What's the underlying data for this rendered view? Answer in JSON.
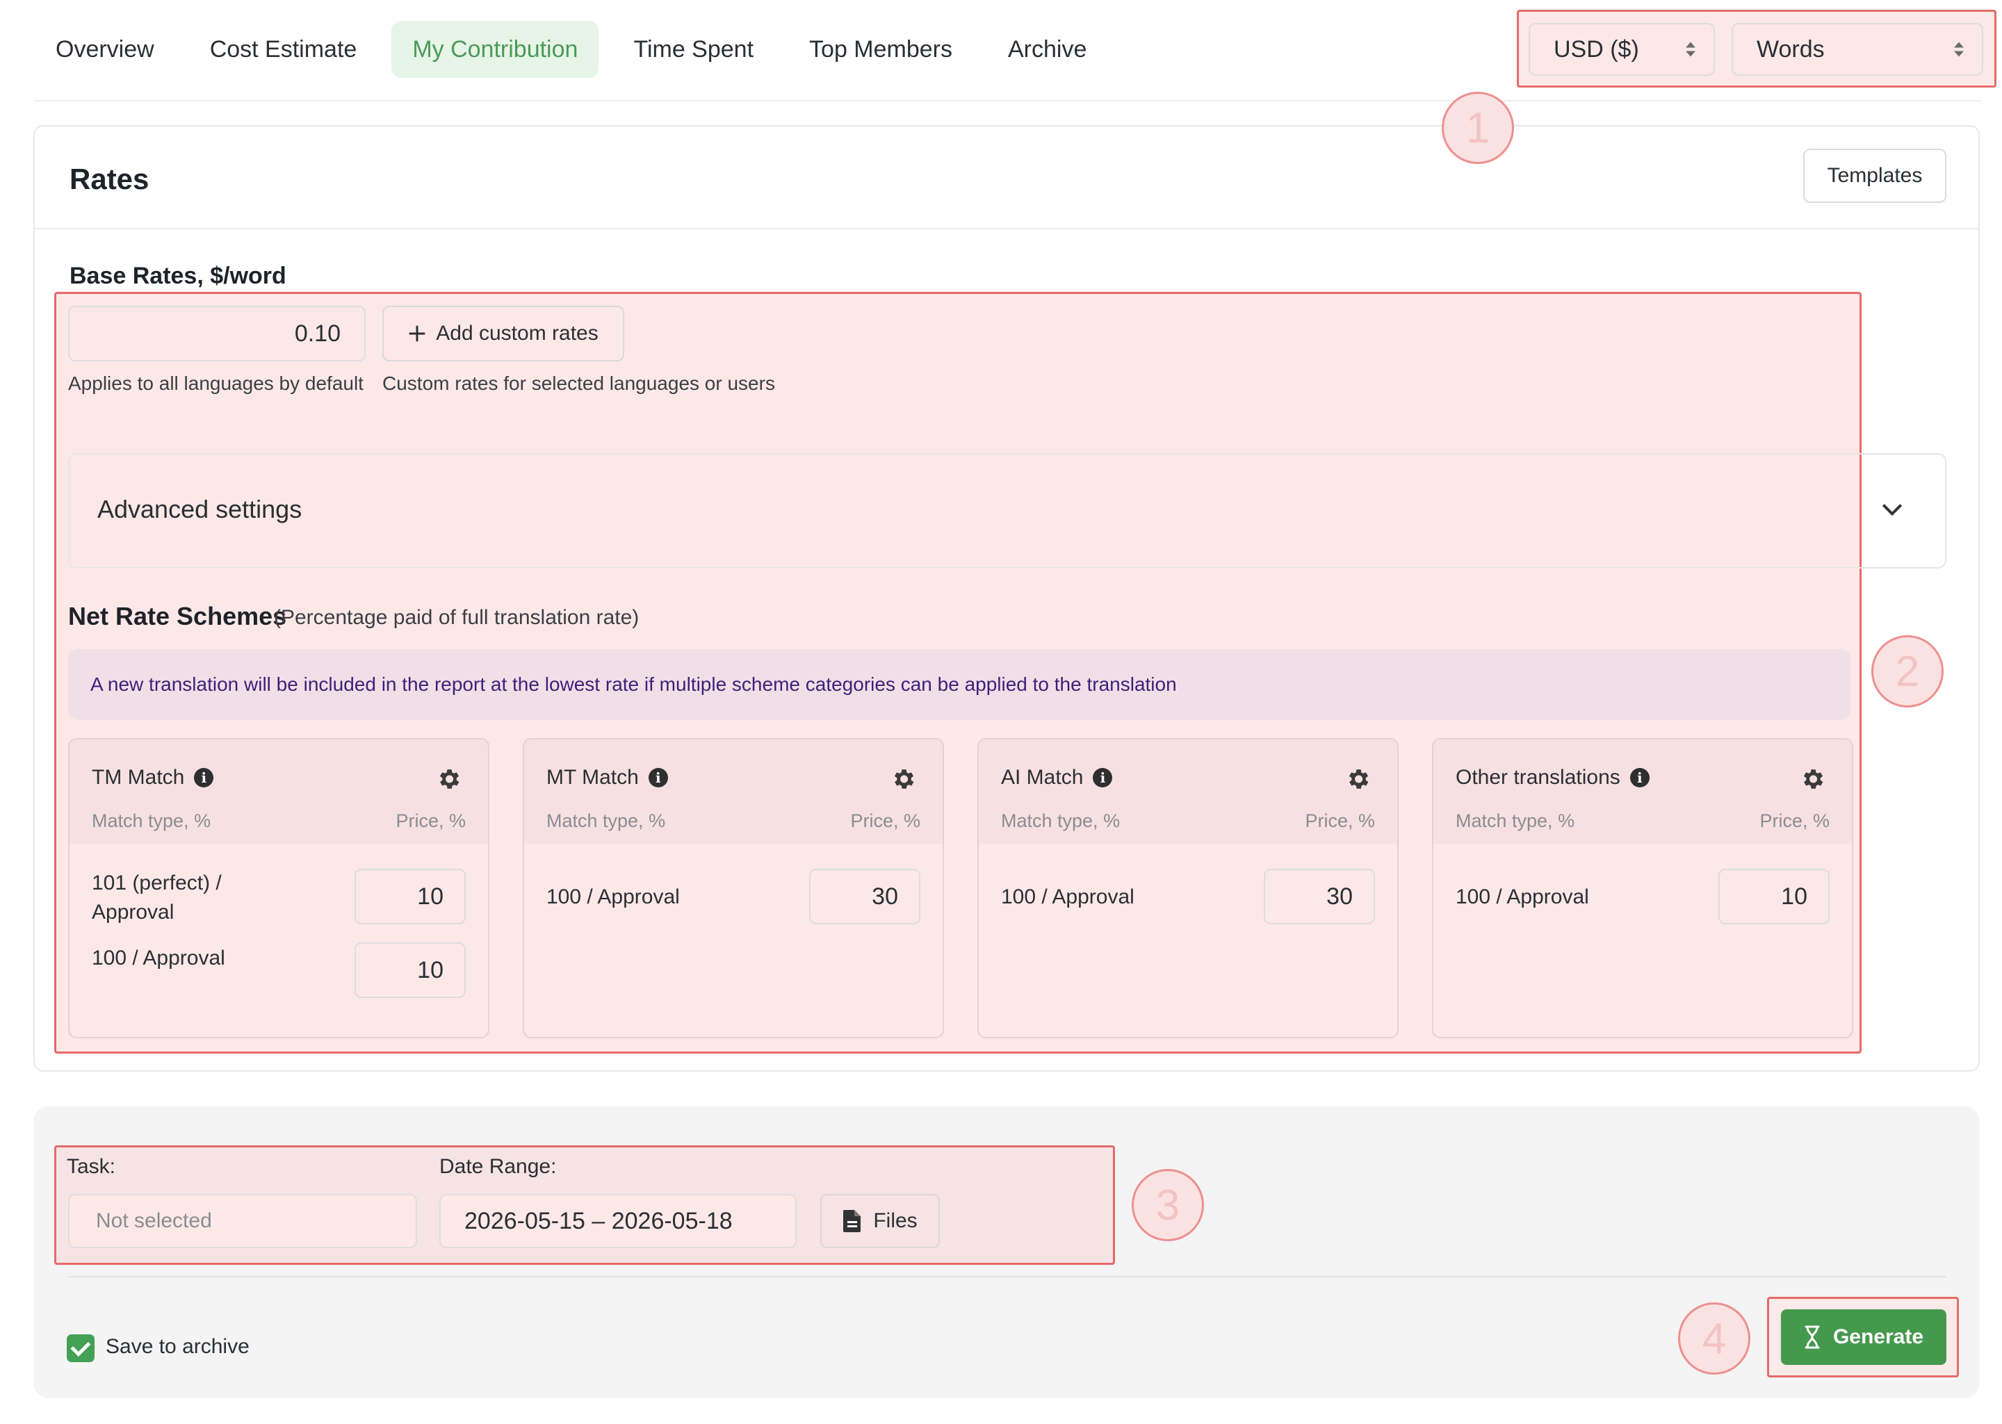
{
  "tabs": [
    {
      "label": "Overview",
      "active": false
    },
    {
      "label": "Cost Estimate",
      "active": false
    },
    {
      "label": "My Contribution",
      "active": true
    },
    {
      "label": "Time Spent",
      "active": false
    },
    {
      "label": "Top Members",
      "active": false
    },
    {
      "label": "Archive",
      "active": false
    }
  ],
  "selects": {
    "currency": "USD ($)",
    "unit": "Words"
  },
  "annotations": [
    "1",
    "2",
    "3",
    "4"
  ],
  "rates": {
    "title": "Rates",
    "templates_label": "Templates",
    "base_title": "Base Rates, $/word",
    "base_value": "0.10",
    "base_hint": "Applies to all languages by default",
    "custom_label": "Add custom rates",
    "custom_hint": "Custom rates for selected languages or users",
    "advanced_label": "Advanced settings",
    "net_title": "Net Rate Schemes",
    "net_subtitle": "(Percentage paid of full translation rate)",
    "banner": "A new translation will be included in the report at the lowest rate if multiple scheme categories can be applied to the translation",
    "col_match": "Match type, %",
    "col_price": "Price, %",
    "schemes": [
      {
        "title": "TM Match",
        "rows": [
          {
            "label": "101 (perfect) / Approval",
            "value": "10"
          },
          {
            "label": "100 / Approval",
            "value": "10"
          }
        ]
      },
      {
        "title": "MT Match",
        "rows": [
          {
            "label": "100 / Approval",
            "value": "30"
          }
        ]
      },
      {
        "title": "AI Match",
        "rows": [
          {
            "label": "100 / Approval",
            "value": "30"
          }
        ]
      },
      {
        "title": "Other translations",
        "rows": [
          {
            "label": "100 / Approval",
            "value": "10"
          }
        ]
      }
    ]
  },
  "report": {
    "task_label": "Task:",
    "task_placeholder": "Not selected",
    "date_label": "Date Range:",
    "date_value": "2026-05-15 – 2026-05-18",
    "files_label": "Files",
    "save_label": "Save to archive",
    "save_checked": true,
    "generate_label": "Generate"
  },
  "colors": {
    "accent": "#45994d",
    "highlight": "#e66a6a"
  }
}
